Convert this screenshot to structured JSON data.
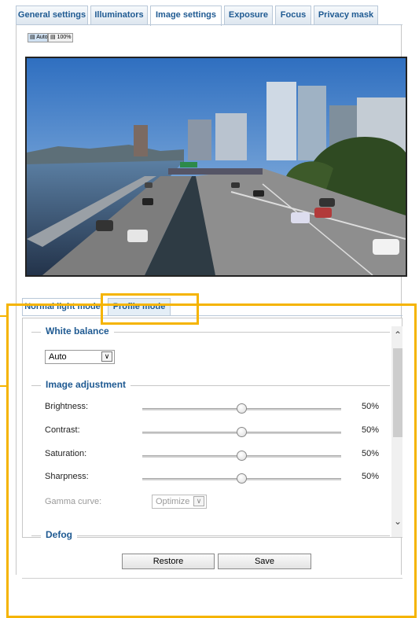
{
  "top_tabs": [
    {
      "label": "General settings",
      "active": false
    },
    {
      "label": "Illuminators",
      "active": false
    },
    {
      "label": "Image settings",
      "active": true
    },
    {
      "label": "Exposure",
      "active": false
    },
    {
      "label": "Focus",
      "active": false
    },
    {
      "label": "Privacy mask",
      "active": false
    }
  ],
  "view_buttons": {
    "auto": "Auto",
    "full": "100%"
  },
  "mode_tabs": [
    {
      "label": "Normal light mode",
      "active": false
    },
    {
      "label": "Profile mode",
      "active": true
    }
  ],
  "sections": {
    "white_balance": "White balance",
    "image_adjustment": "Image adjustment",
    "defog": "Defog"
  },
  "white_balance": {
    "value": "Auto"
  },
  "adjustments": [
    {
      "label": "Brightness:",
      "value": "50%",
      "level": 0.5
    },
    {
      "label": "Contrast:",
      "value": "50%",
      "level": 0.5
    },
    {
      "label": "Saturation:",
      "value": "50%",
      "level": 0.5
    },
    {
      "label": "Sharpness:",
      "value": "50%",
      "level": 0.5
    }
  ],
  "gamma": {
    "label": "Gamma curve:",
    "value": "Optimize"
  },
  "buttons": {
    "restore": "Restore",
    "save": "Save"
  },
  "colors": {
    "accent": "#1f5a92",
    "highlight": "#f5b400"
  }
}
